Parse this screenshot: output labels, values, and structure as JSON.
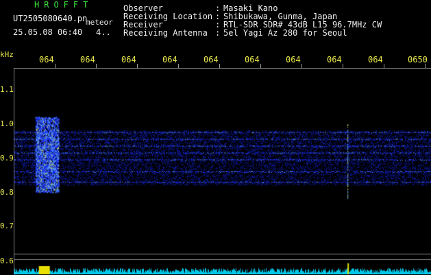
{
  "header": {
    "app_name": "HROFFT",
    "file_name": "UT2505080640.pn",
    "meteor_label": "meteor",
    "datetime": "25.05.08 06:40",
    "count": "4.."
  },
  "info": {
    "observer_label": "Observer",
    "observer_value": "Masaki Kano",
    "location_label": "Receiving Location",
    "location_value": "Shibukawa, Gunma, Japan",
    "receiver_label": "Receiver",
    "receiver_value": "RTL-SDR SDR# 43dB L15 96.7MHz CW",
    "antenna_label": "Receiving Antenna",
    "antenna_value": "5el Yagi Az 280 for Seoul",
    "colon": ":"
  },
  "axes": {
    "y_unit": "kHz",
    "y_ticks": [
      "1.1",
      "1.0",
      "0.9",
      "0.8",
      "0.7",
      "0.6"
    ],
    "x_ticks": [
      "064",
      "064",
      "064",
      "064",
      "064",
      "064",
      "064",
      "064",
      "064",
      "0650"
    ]
  },
  "spectrogram": {
    "signal_band_khz": [
      0.82,
      0.98
    ],
    "horizontal_lines_khz": [
      0.975,
      0.955,
      0.935,
      0.915,
      0.895,
      0.86,
      0.83
    ],
    "meteor_burst_minute_fraction": 0.08,
    "vertical_spike_fraction": 0.8,
    "colors": {
      "noise": "#1a2cff",
      "bright": "#5aa0ff",
      "hot": "#d8e060",
      "baseline": "#00c8e8",
      "burst_bar": "#e8e000"
    }
  }
}
